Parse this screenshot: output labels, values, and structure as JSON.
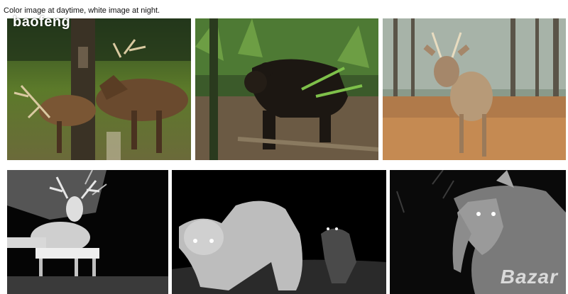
{
  "caption": "Color image at daytime, white image at night.",
  "watermark_text": "baofeng",
  "logo_text": "Bazar",
  "photos": [
    {
      "row": "day",
      "subject": "elk at tree",
      "mode": "color"
    },
    {
      "row": "day",
      "subject": "black bear",
      "mode": "color"
    },
    {
      "row": "day",
      "subject": "white-tailed deer",
      "mode": "color"
    },
    {
      "row": "night",
      "subject": "buck at feeder",
      "mode": "infrared"
    },
    {
      "row": "night",
      "subject": "cougars",
      "mode": "infrared"
    },
    {
      "row": "night",
      "subject": "tapir",
      "mode": "infrared"
    }
  ]
}
